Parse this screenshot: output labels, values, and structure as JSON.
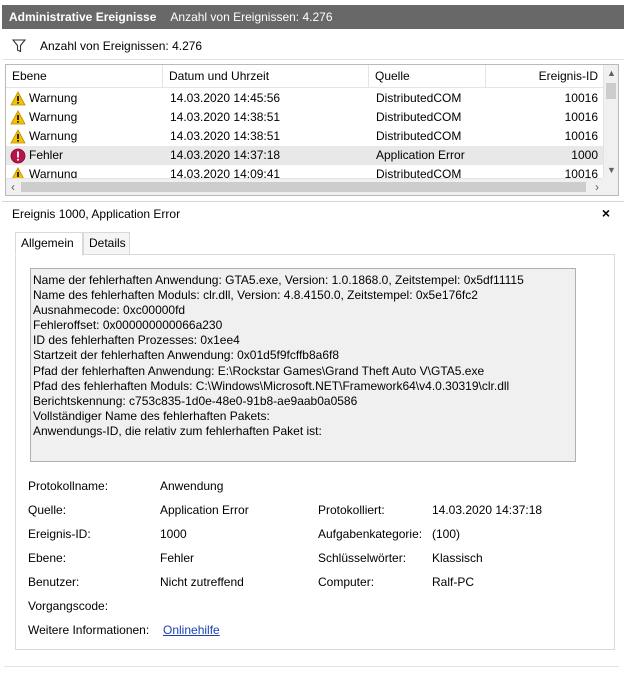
{
  "header": {
    "title": "Administrative Ereignisse",
    "count_text": "Anzahl von Ereignissen: 4.276"
  },
  "filter": {
    "icon": "filter-icon",
    "text": "Anzahl von Ereignissen: 4.276"
  },
  "grid": {
    "columns": [
      "Ebene",
      "Datum und Uhrzeit",
      "Quelle",
      "Ereignis-ID"
    ],
    "rows": [
      {
        "level": "Warnung",
        "icon": "warning-icon",
        "datetime": "14.03.2020 14:45:56",
        "source": "DistributedCOM",
        "id": "10016"
      },
      {
        "level": "Warnung",
        "icon": "warning-icon",
        "datetime": "14.03.2020 14:38:51",
        "source": "DistributedCOM",
        "id": "10016"
      },
      {
        "level": "Warnung",
        "icon": "warning-icon",
        "datetime": "14.03.2020 14:38:51",
        "source": "DistributedCOM",
        "id": "10016"
      },
      {
        "level": "Fehler",
        "icon": "error-icon",
        "datetime": "14.03.2020 14:37:18",
        "source": "Application Error",
        "id": "1000"
      },
      {
        "level": "Warnung",
        "icon": "warning-icon",
        "datetime": "14.03.2020 14:09:41",
        "source": "DistributedCOM",
        "id": "10016"
      }
    ]
  },
  "detail": {
    "title": "Ereignis 1000, Application Error",
    "close": "×",
    "tabs": [
      "Allgemein",
      "Details"
    ],
    "message_lines": [
      "Name der fehlerhaften Anwendung: GTA5.exe, Version: 1.0.1868.0, Zeitstempel: 0x5df11115",
      "Name des fehlerhaften Moduls: clr.dll, Version: 4.8.4150.0, Zeitstempel: 0x5e176fc2",
      "Ausnahmecode: 0xc00000fd",
      "Fehleroffset: 0x000000000066a230",
      "ID des fehlerhaften Prozesses: 0x1ee4",
      "Startzeit der fehlerhaften Anwendung: 0x01d5f9fcffb8a6f8",
      "Pfad der fehlerhaften Anwendung: E:\\Rockstar Games\\Grand Theft Auto V\\GTA5.exe",
      "Pfad des fehlerhaften Moduls: C:\\Windows\\Microsoft.NET\\Framework64\\v4.0.30319\\clr.dll",
      "Berichtskennung: c753c835-1d0e-48e0-91b8-ae9aab0a0586",
      "Vollständiger Name des fehlerhaften Pakets:",
      "Anwendungs-ID, die relativ zum fehlerhaften Paket ist:"
    ],
    "props": {
      "protokollname_label": "Protokollname:",
      "protokollname_value": "Anwendung",
      "quelle_label": "Quelle:",
      "quelle_value": "Application Error",
      "protokolliert_label": "Protokolliert:",
      "protokolliert_value": "14.03.2020 14:37:18",
      "ereignisid_label": "Ereignis-ID:",
      "ereignisid_value": "1000",
      "aufgabe_label": "Aufgabenkategorie:",
      "aufgabe_value": "(100)",
      "ebene_label": "Ebene:",
      "ebene_value": "Fehler",
      "schluessel_label": "Schlüsselwörter:",
      "schluessel_value": "Klassisch",
      "benutzer_label": "Benutzer:",
      "benutzer_value": "Nicht zutreffend",
      "computer_label": "Computer:",
      "computer_value": "Ralf-PC",
      "vorgang_label": "Vorgangscode:",
      "weitere_label": "Weitere Informationen:",
      "weitere_link": "Onlinehilfe"
    }
  }
}
